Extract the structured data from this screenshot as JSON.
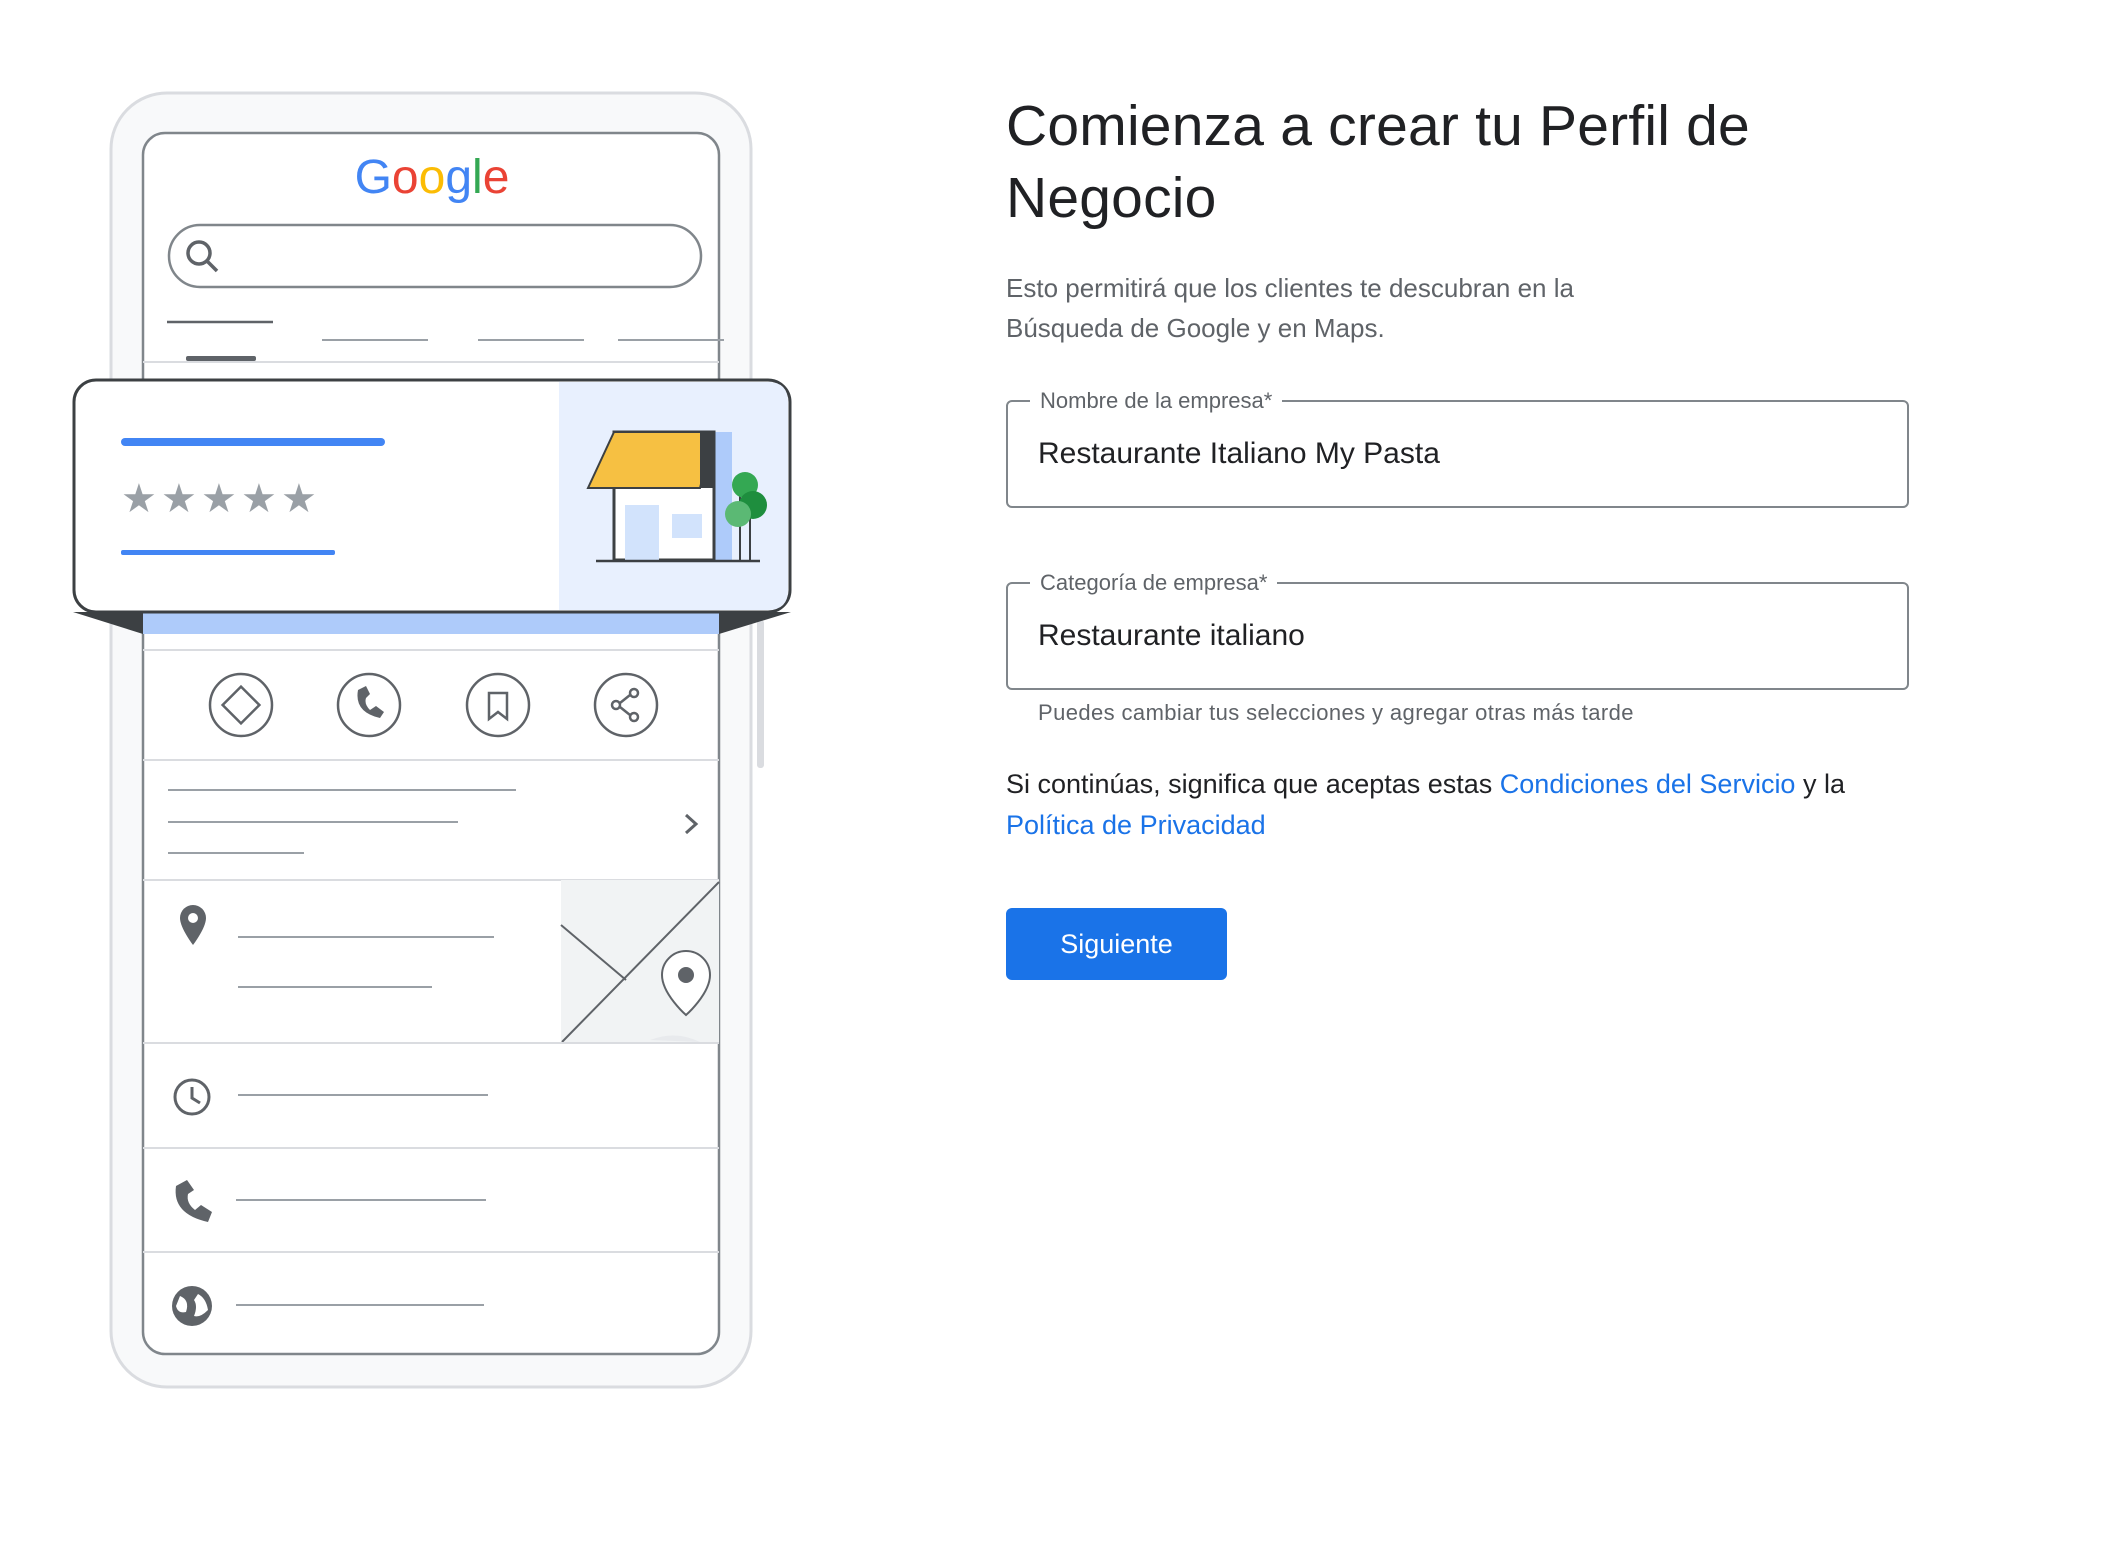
{
  "illustration": {
    "brand": "Google"
  },
  "form": {
    "title": "Comienza a crear tu Perfil de Negocio",
    "subtitle": "Esto permitirá que los clientes te descubran en la Búsqueda de Google y en Maps.",
    "business_name": {
      "label": "Nombre de la empresa*",
      "value": "Restaurante Italiano My Pasta"
    },
    "business_category": {
      "label": "Categoría de empresa*",
      "value": "Restaurante italiano",
      "helper": "Puedes cambiar tus selecciones y agregar otras más tarde"
    },
    "terms": {
      "prefix": "Si continúas, significa que aceptas estas ",
      "tos_link": "Condiciones del Servicio",
      "middle": " y la ",
      "privacy_link": "Política de Privacidad"
    },
    "next_button": "Siguiente"
  },
  "colors": {
    "accent": "#1a73e8",
    "brand_blue": "#4285F4",
    "brand_red": "#EA4335",
    "brand_yellow": "#FBBC05",
    "brand_green": "#34A853"
  }
}
